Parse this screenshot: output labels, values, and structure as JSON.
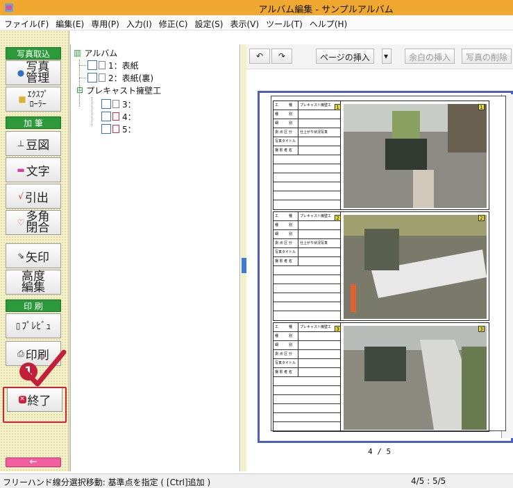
{
  "window": {
    "title": "アルバム編集 - サンプルアルバム"
  },
  "menu": [
    "ファイル(F)",
    "編集(E)",
    "専用(P)",
    "入力(I)",
    "修正(C)",
    "設定(S)",
    "表示(V)",
    "ツール(T)",
    "ヘルプ(H)"
  ],
  "left": {
    "photo_section": "写真取込",
    "photo_mgmt_top": "写真",
    "photo_mgmt_bottom": "管理",
    "explorer_top": "ｴｸｽﾌﾟ",
    "explorer_bottom": "ﾛｰﾗｰ",
    "add_section": "加 筆",
    "bean": "豆図",
    "text": "文字",
    "leader": "引出",
    "polygon_top": "多角",
    "polygon_bottom": "閉合",
    "arrow": "矢印",
    "height_top": "高度",
    "height_bottom": "編集",
    "print_section": "印 刷",
    "preview": "ﾌﾟﾚﾋﾞｭ",
    "print": "印刷",
    "exit": "終了",
    "back": "←"
  },
  "tree": {
    "root": "アルバム",
    "items": [
      "1：表紙",
      "2：表紙(裏)"
    ],
    "folder": "プレキャスト擁壁工",
    "subitems": [
      "3：",
      "4：",
      "5："
    ]
  },
  "toolbar": {
    "insert_page": "ページの挿入",
    "insert_blank": "余白の挿入",
    "delete_photo": "写真の削除"
  },
  "page": {
    "table_rows": [
      "工　　　種",
      "種　　　別",
      "細　　　別",
      "測 点 区 分",
      "写真タイトル",
      "撮 影 者 名"
    ],
    "row_values": [
      "プレキャスト擁壁工",
      "",
      "",
      "仕上がり状況写真",
      "",
      ""
    ],
    "block_numbers": [
      "1",
      "2",
      "3"
    ],
    "page_count": "4 / 5"
  },
  "status": {
    "message": "フリーハンド線分選択移動: 基準点を指定 ( [Ctrl]追加 )",
    "position": "4/5 : 5/5"
  },
  "callout": {
    "number": "1"
  },
  "colors": {
    "titlebar": "#f0a830",
    "section": "#2c9a3a",
    "accent": "#4a5fc0",
    "callout": "#c2203a"
  }
}
